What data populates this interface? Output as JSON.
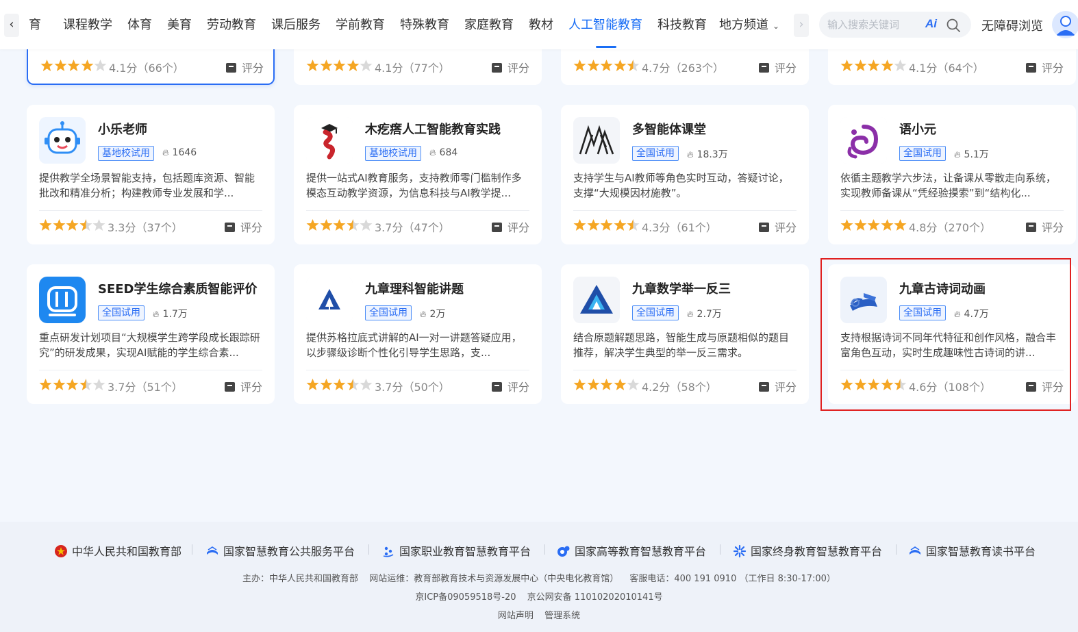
{
  "nav": {
    "tabs": [
      "育",
      "课程教学",
      "体育",
      "美育",
      "劳动教育",
      "课后服务",
      "学前教育",
      "特殊教育",
      "家庭教育",
      "教材",
      "人工智能教育",
      "科技教育",
      "地方频道"
    ],
    "active_index": 10,
    "search_placeholder": "输入搜索关键词",
    "ai_label": "Ai",
    "accessibility": "无障碍浏览"
  },
  "rate_label": "评分",
  "top_row": [
    {
      "stars": 4.0,
      "score": "4.1分（66个）"
    },
    {
      "stars": 4.0,
      "score": "4.1分（77个）"
    },
    {
      "stars": 4.5,
      "score": "4.7分（263个）"
    },
    {
      "stars": 4.0,
      "score": "4.1分（64个）"
    }
  ],
  "cards": [
    {
      "title": "小乐老师",
      "tag": "基地校试用",
      "heat": "1646",
      "desc": "提供教学全场景智能支持，包括题库资源、智能批改和精准分析；构建教师专业发展和学...",
      "stars": 3.5,
      "score": "3.3分（37个）",
      "logo": "robot-logo"
    },
    {
      "title": "木疙瘩人工智能教育实践",
      "tag": "基地校试用",
      "heat": "684",
      "desc": "提供一站式AI教育服务，支持教师零门槛制作多模态互动教学资源，为信息科技与AI教学提...",
      "stars": 3.5,
      "score": "3.7分（47个）",
      "logo": "mugeda-logo"
    },
    {
      "title": "多智能体课堂",
      "tag": "全国试用",
      "heat": "18.3万",
      "desc": "支持学生与AI教师等角色实时互动，答疑讨论，支撑“大规模因材施教”。",
      "stars": 4.5,
      "score": "4.3分（61个）",
      "logo": "multiagent-logo"
    },
    {
      "title": "语小元",
      "tag": "全国试用",
      "heat": "5.1万",
      "desc": "依循主题教学六步法，让备课从零散走向系统，实现教师备课从“凭经验摸索”到“结构化...",
      "stars": 5.0,
      "score": "4.8分（270个）",
      "logo": "yuxiaoyuan-logo"
    },
    {
      "title": "SEED学生综合素质智能评价",
      "tag": "全国试用",
      "heat": "1.7万",
      "desc": "重点研发计划项目“大规模学生跨学段成长跟踪研究”的研发成果，实现AI赋能的学生综合素...",
      "stars": 3.5,
      "score": "3.7分（51个）",
      "logo": "seed-logo"
    },
    {
      "title": "九章理科智能讲题",
      "tag": "全国试用",
      "heat": "2万",
      "desc": "提供苏格拉底式讲解的AI一对一讲题答疑应用，以步骤级诊断个性化引导学生思路，支...",
      "stars": 3.5,
      "score": "3.7分（50个）",
      "logo": "jiuzhang-science-logo"
    },
    {
      "title": "九章数学举一反三",
      "tag": "全国试用",
      "heat": "2.7万",
      "desc": "结合原题解题思路，智能生成与原题相似的题目推荐，解决学生典型的举一反三需求。",
      "stars": 4.0,
      "score": "4.2分（58个）",
      "logo": "jiuzhang-math-logo"
    },
    {
      "title": "九章古诗词动画",
      "tag": "全国试用",
      "heat": "4.7万",
      "desc": "支持根据诗词不同年代特征和创作风格，融合丰富角色互动，实时生成趣味性古诗词的讲...",
      "stars": 4.5,
      "score": "4.6分（108个）",
      "logo": "poetry-logo"
    }
  ],
  "footer": {
    "links": [
      "中华人民共和国教育部",
      "国家智慧教育公共服务平台",
      "国家职业教育智慧教育平台",
      "国家高等教育智慧教育平台",
      "国家终身教育智慧教育平台",
      "国家智慧教育读书平台"
    ],
    "host": "主办：中华人民共和国教育部",
    "ops": "网站运维：教育部教育技术与资源发展中心（中央电化教育馆）",
    "service": "客服电话：400 191 0910 （工作日 8:30-17:00）",
    "icp": "京ICP备09059518号-20",
    "police": "京公网安备 11010202010141号",
    "statement": "网站声明",
    "admin": "管理系统"
  },
  "colors": {
    "accent": "#1a6ef5",
    "star": "#f5a623",
    "star_empty": "#d9d9d9",
    "highlight": "#e02020"
  }
}
